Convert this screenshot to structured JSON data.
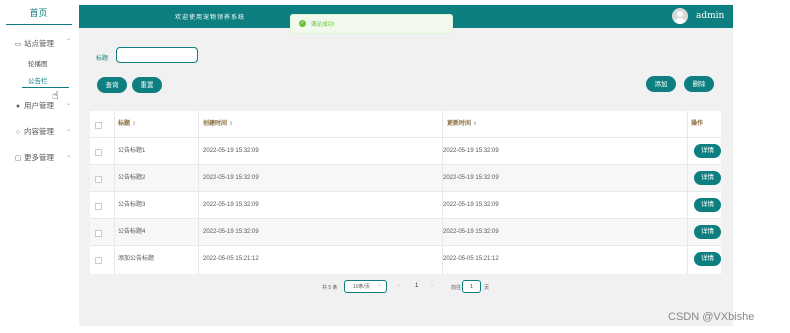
{
  "sidebar": {
    "home": "首页",
    "menus": [
      {
        "label": "站点管理",
        "icon": "monitor-icon"
      },
      {
        "label": "用户管理",
        "icon": "user-icon"
      },
      {
        "label": "内容管理",
        "icon": "chat-icon"
      },
      {
        "label": "更多管理",
        "icon": "message-icon"
      }
    ],
    "sub_items": [
      "轮播图",
      "公告栏"
    ]
  },
  "header": {
    "title": "欢迎使用宠物领养系统",
    "user": "admin"
  },
  "toast": {
    "message": "满足成功!"
  },
  "search": {
    "label": "标题",
    "placeholder": "",
    "value": ""
  },
  "buttons": {
    "query": "查询",
    "reset": "重置",
    "add": "添加",
    "delete": "删除"
  },
  "table": {
    "columns": [
      "标题",
      "创建时间",
      "更新时间",
      "操作"
    ],
    "sort_icon": "⇕",
    "action_label": "详情",
    "rows": [
      {
        "title": "公告标题1",
        "created": "2022-05-19 15:32:09",
        "updated": "2022-05-19 15:32:09"
      },
      {
        "title": "公告标题2",
        "created": "2022-05-19 15:32:09",
        "updated": "2022-05-19 15:32:09"
      },
      {
        "title": "公告标题3",
        "created": "2022-05-19 15:32:09",
        "updated": "2022-05-19 15:32:09"
      },
      {
        "title": "公告标题4",
        "created": "2022-05-19 15:32:09",
        "updated": "2022-05-19 15:32:09"
      },
      {
        "title": "添加公告标题",
        "created": "2022-05-05 15:21:12",
        "updated": "2022-05-05 15:21:12"
      }
    ]
  },
  "pagination": {
    "total": "共 5 条",
    "page_size": "10条/页",
    "current_page": "1",
    "goto_label": "前往",
    "goto_value": "1",
    "page_suffix": "页"
  },
  "watermark": "CSDN @VXbishe",
  "colors": {
    "accent": "#0d7f80",
    "success": "#67c23a"
  }
}
